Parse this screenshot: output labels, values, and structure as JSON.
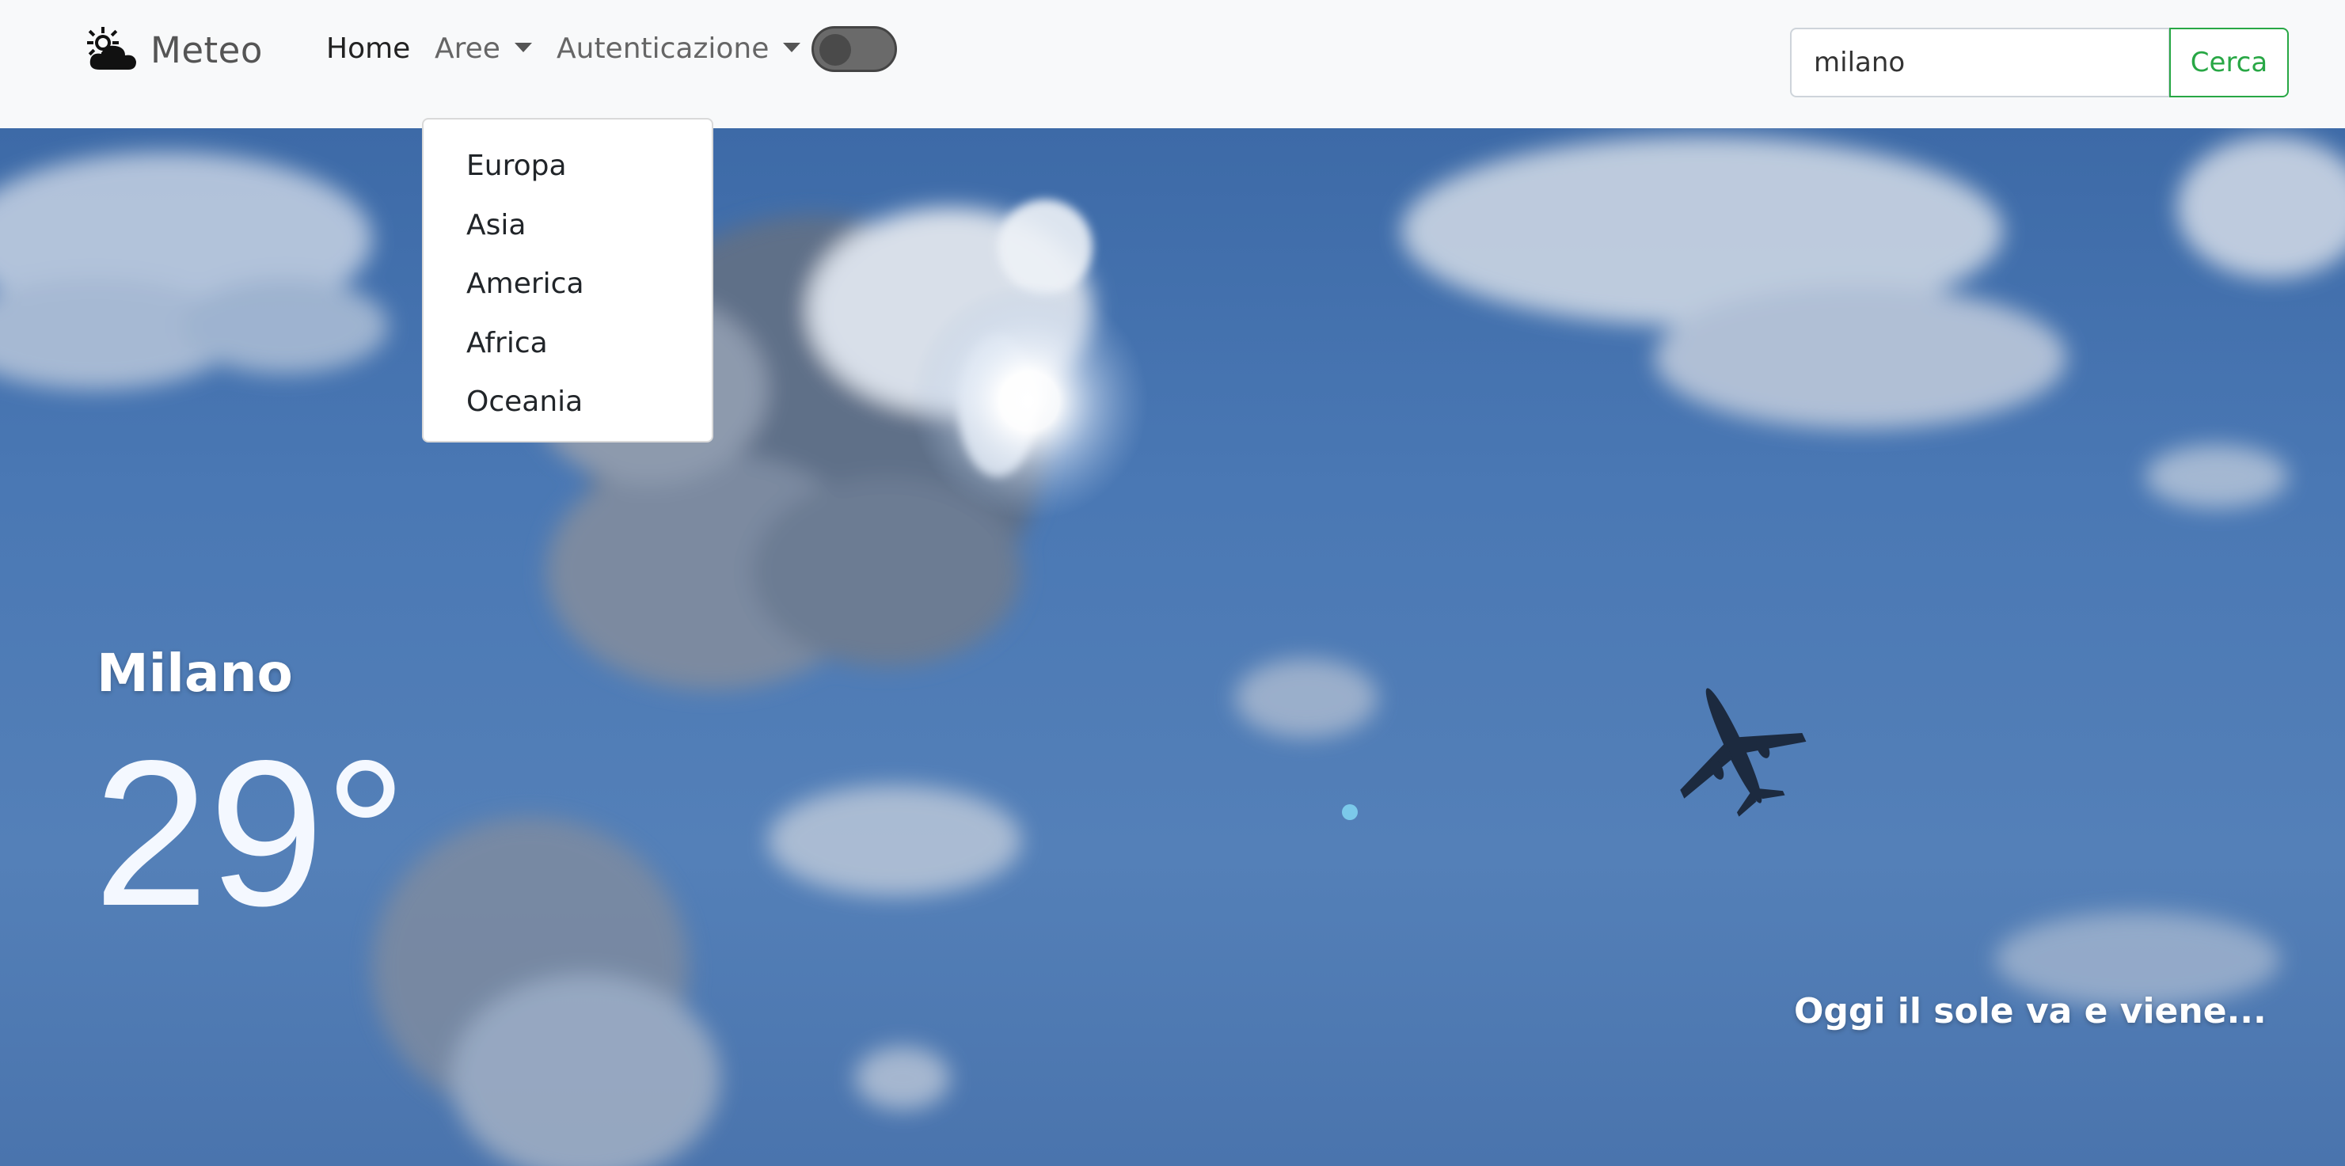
{
  "navbar": {
    "brand": "Meteo",
    "links": {
      "home": "Home",
      "areas": "Aree",
      "auth": "Autenticazione"
    },
    "theme_toggle_checked": false
  },
  "areas_dropdown": {
    "items": [
      "Europa",
      "Asia",
      "America",
      "Africa",
      "Oceania"
    ]
  },
  "search": {
    "value": "milano",
    "button_label": "Cerca"
  },
  "weather": {
    "city": "Milano",
    "temperature": "29°",
    "message": "Oggi il sole va e viene..."
  },
  "colors": {
    "navbar_bg": "#f8f9fa",
    "accent_green": "#28a745",
    "sky_blue": "#4a78b4"
  }
}
